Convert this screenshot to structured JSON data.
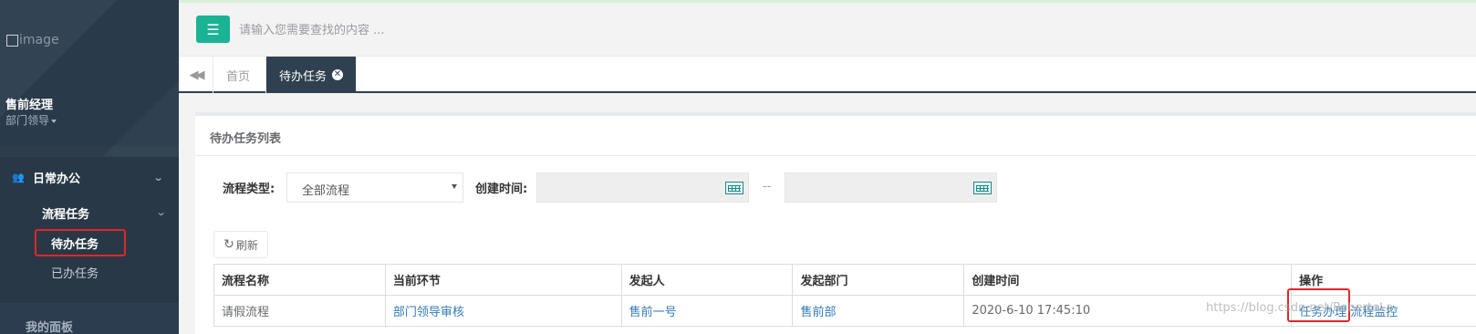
{
  "sidebar": {
    "profile_image_alt": "image",
    "user_name": "售前经理",
    "user_role": "部门领导",
    "menu": {
      "group_label": "日常办公",
      "sub_label": "流程任务",
      "items": [
        {
          "label": "待办任务",
          "active": true
        },
        {
          "label": "已办任务",
          "active": false
        }
      ],
      "next_group_label": "我的面板"
    }
  },
  "topbar": {
    "search_placeholder": "请输入您需要查找的内容 ..."
  },
  "tabs": {
    "home_label": "首页",
    "active_label": "待办任务"
  },
  "panel": {
    "title": "待办任务列表",
    "filters": {
      "process_type_label": "流程类型:",
      "process_type_value": "全部流程",
      "created_time_label": "创建时间:",
      "range_separator": "--"
    },
    "refresh_label": "刷新",
    "table": {
      "headers": [
        "流程名称",
        "当前环节",
        "发起人",
        "发起部门",
        "创建时间",
        "操作"
      ],
      "rows": [
        {
          "process_name": "请假流程",
          "current_step": "部门领导审核",
          "initiator": "售前一号",
          "department": "售前部",
          "created_time": "2020-6-10 17:45:10",
          "actions": [
            "任务办理",
            "流程监控"
          ]
        }
      ]
    }
  },
  "watermark": "https://blog.csdn.net/RobertoLa",
  "colors": {
    "sidebar_bg": "#2f4050",
    "accent": "#1ab394",
    "link": "#337ab7",
    "highlight": "#e2262a"
  }
}
